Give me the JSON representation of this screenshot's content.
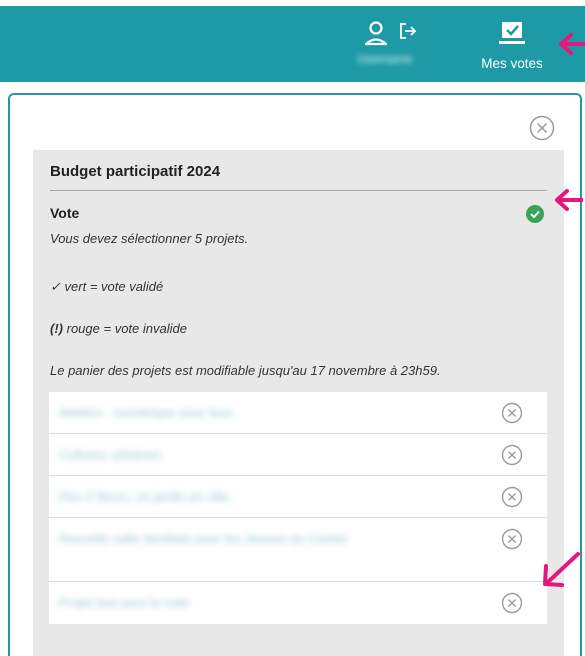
{
  "header": {
    "user_name": "Username",
    "votes_label": "Mes votes",
    "user_icon": "user-icon",
    "logout_icon": "logout-icon",
    "votes_icon": "ballot-box-icon",
    "color": "#1e9aa6"
  },
  "modal": {
    "close_icon": "close-circle-icon",
    "panel": {
      "title": "Budget participatif 2024",
      "vote_label": "Vote",
      "instruction": "Vous devez sélectionner 5 projets.",
      "legend_valid_mark": "✓",
      "legend_valid_text": "vert = vote validé",
      "legend_invalid_mark": "(!)",
      "legend_invalid_text": "rouge = vote invalide",
      "deadline": "Le panier des projets est modifiable jusqu'au 17 novembre à 23h59.",
      "status": "valid",
      "status_color": "#3aa35a",
      "projects": [
        {
          "name": "Ateliers - numérique pour tous"
        },
        {
          "name": "Cultures urbaines"
        },
        {
          "name": "Des 2 fleurs, un jardin en ville"
        },
        {
          "name": "Nouvelle salle familiale pour les Jeunes du Centre"
        },
        {
          "name": "Projet test pour le vote"
        }
      ]
    }
  },
  "annotations": {
    "arrow_color": "#e5177e"
  }
}
